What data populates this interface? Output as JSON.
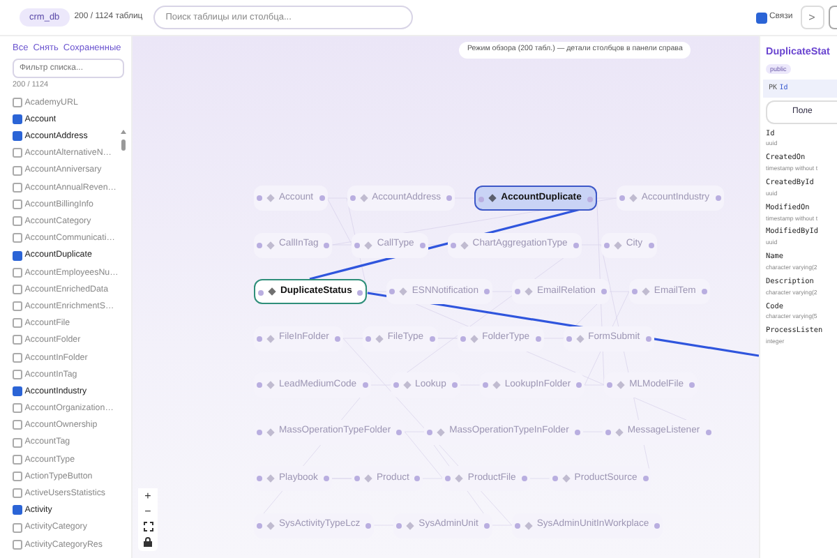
{
  "top_bar": {
    "database": "crm_db",
    "table_count": "200 / 1124 таблиц",
    "search": {
      "placeholder": "Поиск таблицы или столбца..."
    },
    "relations_toggle": {
      "label": "Связи",
      "checked": true
    },
    "next_button": {
      "label": ">"
    }
  },
  "sidebar": {
    "actions": [
      "Все",
      "Снять",
      "Сохраненные"
    ],
    "filter": {
      "placeholder": "Фильтр списка..."
    },
    "count": "200 / 1124",
    "items": [
      {
        "label": "AcademyURL",
        "checked": false
      },
      {
        "label": "Account",
        "checked": true
      },
      {
        "label": "AccountAddress",
        "checked": true
      },
      {
        "label": "AccountAlternativeN…",
        "checked": false
      },
      {
        "label": "AccountAnniversary",
        "checked": false
      },
      {
        "label": "AccountAnnualReven…",
        "checked": false
      },
      {
        "label": "AccountBillingInfo",
        "checked": false
      },
      {
        "label": "AccountCategory",
        "checked": false
      },
      {
        "label": "AccountCommunicati…",
        "checked": false
      },
      {
        "label": "AccountDuplicate",
        "checked": true
      },
      {
        "label": "AccountEmployeesNu…",
        "checked": false
      },
      {
        "label": "AccountEnrichedData",
        "checked": false
      },
      {
        "label": "AccountEnrichmentS…",
        "checked": false
      },
      {
        "label": "AccountFile",
        "checked": false
      },
      {
        "label": "AccountFolder",
        "checked": false
      },
      {
        "label": "AccountInFolder",
        "checked": false
      },
      {
        "label": "AccountInTag",
        "checked": false
      },
      {
        "label": "AccountIndustry",
        "checked": true
      },
      {
        "label": "AccountOrganization…",
        "checked": false
      },
      {
        "label": "AccountOwnership",
        "checked": false
      },
      {
        "label": "AccountTag",
        "checked": false
      },
      {
        "label": "AccountType",
        "checked": false
      },
      {
        "label": "ActionTypeButton",
        "checked": false
      },
      {
        "label": "ActiveUsersStatistics",
        "checked": false
      },
      {
        "label": "Activity",
        "checked": true
      },
      {
        "label": "ActivityCategory",
        "checked": false
      },
      {
        "label": "ActivityCategoryRes",
        "checked": false
      }
    ]
  },
  "canvas": {
    "banner": "Режим обзора (200 табл.) — детали столбцов в панели справа",
    "rows": [
      {
        "nodes": [
          {
            "label": "Account",
            "kind": "other"
          },
          {
            "label": "AccountAddress",
            "kind": "other"
          },
          {
            "label": "AccountDuplicate",
            "kind": "related"
          },
          {
            "label": "AccountIndustry",
            "kind": "other"
          }
        ]
      },
      {
        "nodes": [
          {
            "label": "CallInTag",
            "kind": "other"
          },
          {
            "label": "CallType",
            "kind": "other"
          },
          {
            "label": "ChartAggregationType",
            "kind": "other"
          },
          {
            "label": "City",
            "kind": "other"
          }
        ]
      },
      {
        "nodes": [
          {
            "label": "DuplicateStatus",
            "kind": "selected"
          },
          {
            "label": "ESNNotification",
            "kind": "other"
          },
          {
            "label": "EmailRelation",
            "kind": "other"
          },
          {
            "label": "EmailTem",
            "kind": "other"
          }
        ]
      },
      {
        "nodes": [
          {
            "label": "FileInFolder",
            "kind": "other"
          },
          {
            "label": "FileType",
            "kind": "other"
          },
          {
            "label": "FolderType",
            "kind": "other"
          },
          {
            "label": "FormSubmit",
            "kind": "other"
          }
        ]
      },
      {
        "nodes": [
          {
            "label": "LeadMediumCode",
            "kind": "other"
          },
          {
            "label": "Lookup",
            "kind": "other"
          },
          {
            "label": "LookupInFolder",
            "kind": "other"
          },
          {
            "label": "MLModelFile",
            "kind": "other"
          }
        ]
      },
      {
        "nodes": [
          {
            "label": "MassOperationTypeFolder",
            "kind": "other"
          },
          {
            "label": "MassOperationTypeInFolder",
            "kind": "other"
          },
          {
            "label": "MessageListener",
            "kind": "other"
          }
        ]
      },
      {
        "nodes": [
          {
            "label": "Playbook",
            "kind": "other"
          },
          {
            "label": "Product",
            "kind": "other"
          },
          {
            "label": "ProductFile",
            "kind": "other"
          },
          {
            "label": "ProductSource",
            "kind": "other"
          }
        ]
      },
      {
        "nodes": [
          {
            "label": "SysActivityTypeLcz",
            "kind": "other"
          },
          {
            "label": "SysAdminUnit",
            "kind": "other"
          },
          {
            "label": "SysAdminUnitInWorkplace",
            "kind": "other"
          }
        ]
      }
    ],
    "zoom_controls": [
      "+",
      "−"
    ]
  },
  "detail_panel": {
    "title": "DuplicateStat",
    "schema": "public",
    "primary_key": {
      "tag": "PK",
      "column": "Id"
    },
    "tab": "Поле",
    "columns": [
      {
        "name": "Id",
        "type": "uuid"
      },
      {
        "name": "CreatedOn",
        "type": "timestamp without t"
      },
      {
        "name": "CreatedById",
        "type": "uuid"
      },
      {
        "name": "ModifiedOn",
        "type": "timestamp without t"
      },
      {
        "name": "ModifiedById",
        "type": "uuid"
      },
      {
        "name": "Name",
        "type": "character varying(2"
      },
      {
        "name": "Description",
        "type": "character varying(2"
      },
      {
        "name": "Code",
        "type": "character varying(5"
      },
      {
        "name": "ProcessListen",
        "type": "integer"
      }
    ]
  }
}
